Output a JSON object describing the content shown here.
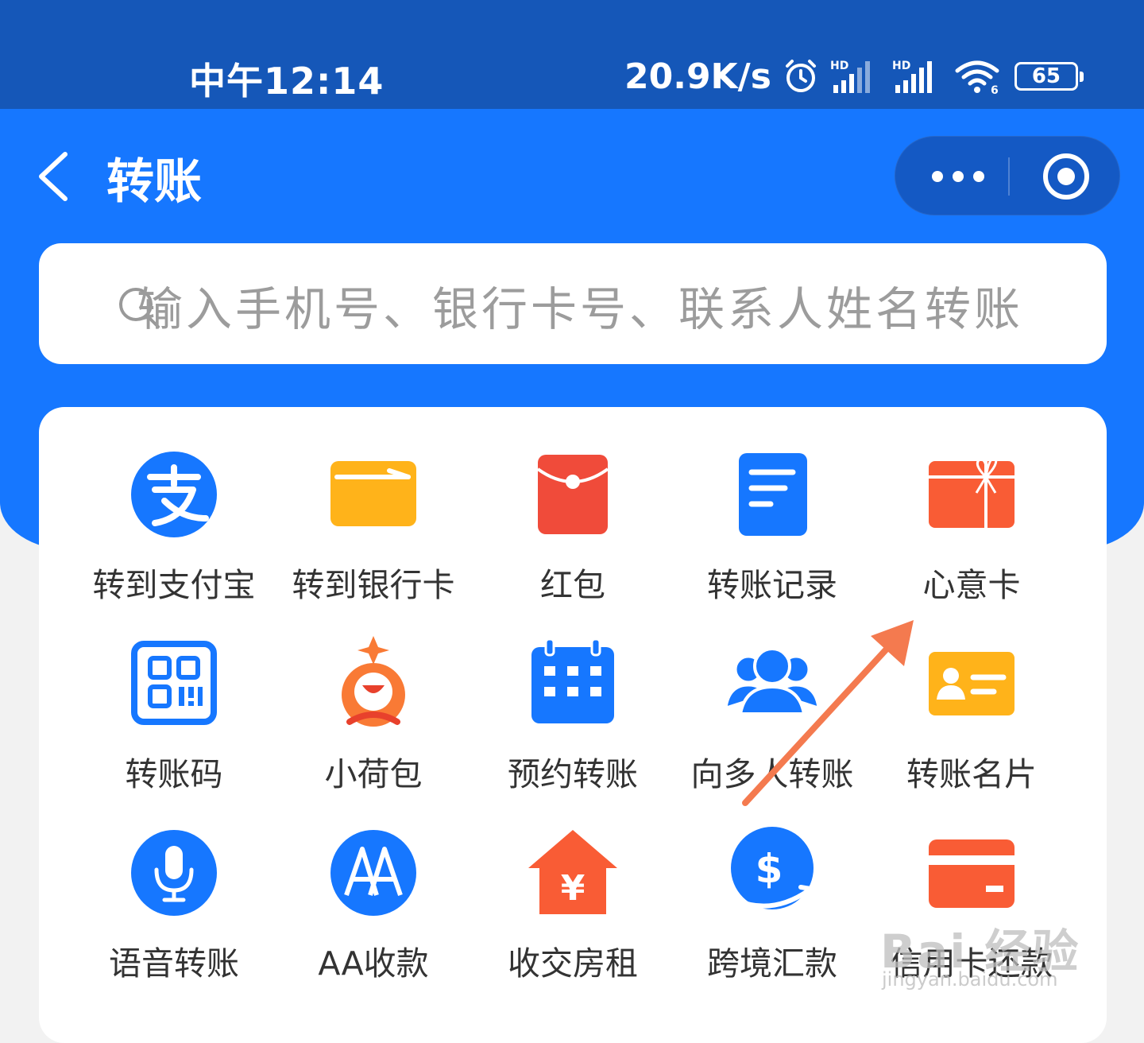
{
  "status_bar": {
    "time": "中午12:14",
    "net_speed": "20.9K/s",
    "battery": "65",
    "icons": [
      "alarm-icon",
      "hd-signal-icon",
      "hd-signal-icon",
      "wifi-icon",
      "battery-icon"
    ]
  },
  "header": {
    "title": "转账",
    "back_icon": "back-chevron-icon",
    "menu_icons": [
      "more-dots-icon",
      "target-circle-icon"
    ]
  },
  "search": {
    "placeholder": "输入手机号、银行卡号、联系人姓名转账",
    "icon": "search-icon"
  },
  "grid": {
    "items": [
      {
        "label": "转到支付宝",
        "icon": "alipay-icon",
        "color": "#1677ff"
      },
      {
        "label": "转到银行卡",
        "icon": "bank-card-icon",
        "color": "#ffb31a"
      },
      {
        "label": "红包",
        "icon": "red-envelope-icon",
        "color": "#f04b3a"
      },
      {
        "label": "转账记录",
        "icon": "document-icon",
        "color": "#1677ff"
      },
      {
        "label": "心意卡",
        "icon": "gift-card-icon",
        "color": "#f95c35"
      },
      {
        "label": "转账码",
        "icon": "qr-code-icon",
        "color": "#1677ff"
      },
      {
        "label": "小荷包",
        "icon": "purse-icon",
        "color": "#f97a35"
      },
      {
        "label": "预约转账",
        "icon": "calendar-icon",
        "color": "#1677ff"
      },
      {
        "label": "向多人转账",
        "icon": "group-people-icon",
        "color": "#1677ff"
      },
      {
        "label": "转账名片",
        "icon": "contact-card-icon",
        "color": "#ffb31a"
      },
      {
        "label": "语音转账",
        "icon": "microphone-icon",
        "color": "#1677ff"
      },
      {
        "label": "AA收款",
        "icon": "aa-icon",
        "color": "#1677ff"
      },
      {
        "label": "收交房租",
        "icon": "house-rent-icon",
        "color": "#f95c35"
      },
      {
        "label": "跨境汇款",
        "icon": "dollar-transfer-icon",
        "color": "#1677ff"
      },
      {
        "label": "信用卡还款",
        "icon": "credit-card-icon",
        "color": "#f95c35"
      }
    ]
  },
  "annotation": {
    "arrow_color": "#f47a4f"
  },
  "watermark": {
    "text": "Bai 经验",
    "url": "jingyan.baidu.com"
  }
}
